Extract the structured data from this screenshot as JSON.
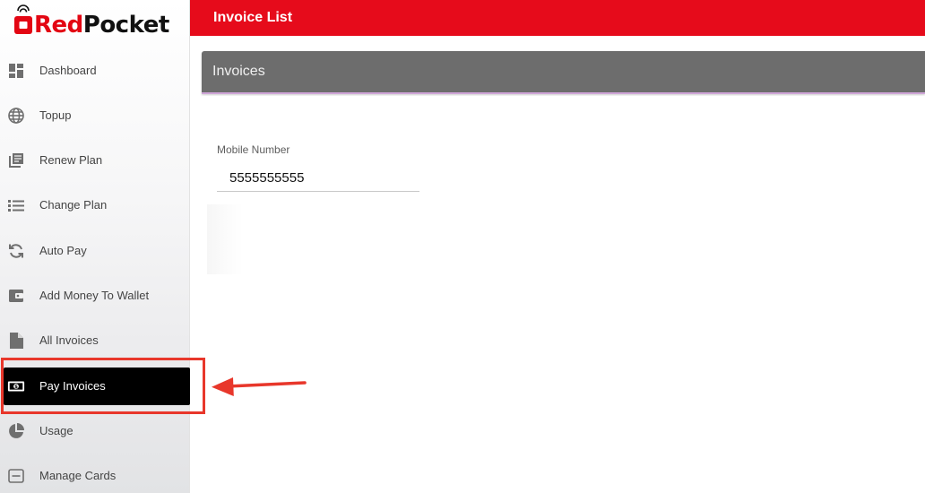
{
  "brand": {
    "name_red": "Red",
    "name_dark": "Pocket",
    "color": "#e30613"
  },
  "topbar": {
    "title": "Invoice List",
    "color": "#e60b1b"
  },
  "sidebar": {
    "items": [
      {
        "label": "Dashboard",
        "icon": "dashboard-icon"
      },
      {
        "label": "Topup",
        "icon": "globe-icon"
      },
      {
        "label": "Renew Plan",
        "icon": "library-books-icon"
      },
      {
        "label": "Change Plan",
        "icon": "list-icon"
      },
      {
        "label": "Auto Pay",
        "icon": "refresh-icon"
      },
      {
        "label": "Add Money To Wallet",
        "icon": "wallet-icon"
      },
      {
        "label": "All Invoices",
        "icon": "document-icon"
      },
      {
        "label": "Pay Invoices",
        "icon": "money-bill-icon",
        "active": true
      },
      {
        "label": "Usage",
        "icon": "pie-chart-icon"
      },
      {
        "label": "Manage Cards",
        "icon": "card-icon"
      }
    ]
  },
  "main": {
    "card_title": "Invoices",
    "mobile_field": {
      "label": "Mobile Number",
      "value": "5555555555"
    }
  },
  "annotation": {
    "color": "#e8372b",
    "target": "Pay Invoices"
  }
}
